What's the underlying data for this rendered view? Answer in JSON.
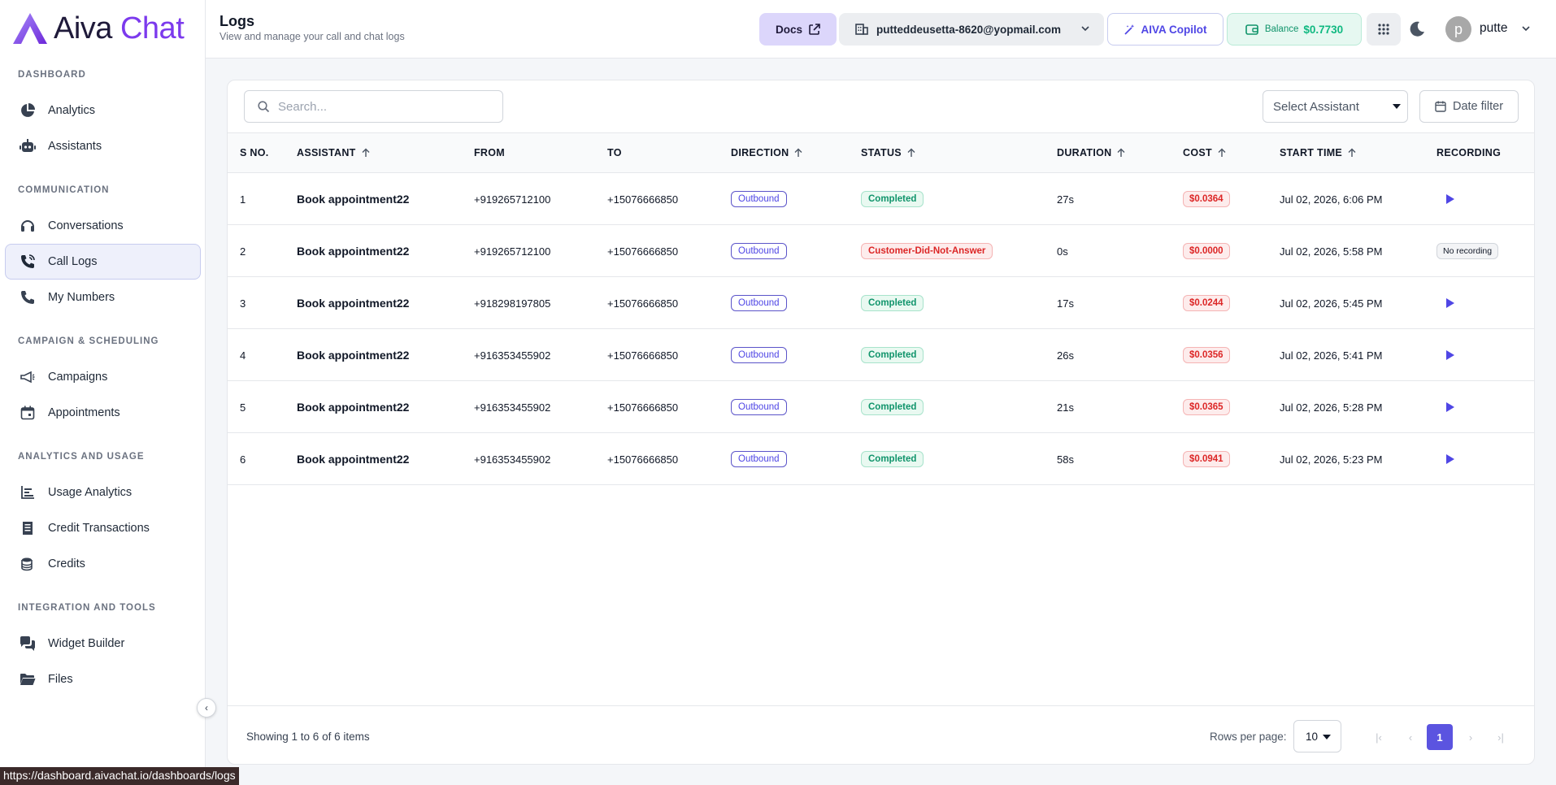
{
  "brand": {
    "name_part1": "Aiva",
    "name_part2": "Chat"
  },
  "header": {
    "title": "Logs",
    "subtitle": "View and manage your call and chat logs",
    "docs_label": "Docs",
    "account_email": "putteddeusetta-8620@yopmail.com",
    "copilot_label": "AIVA Copilot",
    "balance_label": "Balance",
    "balance_value": "$0.7730",
    "avatar_letter": "p",
    "username": "putte"
  },
  "sidebar": {
    "sections": [
      {
        "label": "DASHBOARD",
        "items": [
          {
            "label": "Analytics",
            "icon": "pie-chart-icon"
          },
          {
            "label": "Assistants",
            "icon": "robot-icon"
          }
        ]
      },
      {
        "label": "COMMUNICATION",
        "items": [
          {
            "label": "Conversations",
            "icon": "headset-icon"
          },
          {
            "label": "Call Logs",
            "icon": "phone-call-icon",
            "active": true
          },
          {
            "label": "My Numbers",
            "icon": "phone-icon"
          }
        ]
      },
      {
        "label": "CAMPAIGN & SCHEDULING",
        "items": [
          {
            "label": "Campaigns",
            "icon": "megaphone-icon"
          },
          {
            "label": "Appointments",
            "icon": "calendar-icon"
          }
        ]
      },
      {
        "label": "ANALYTICS AND USAGE",
        "items": [
          {
            "label": "Usage Analytics",
            "icon": "bar-chart-icon"
          },
          {
            "label": "Credit Transactions",
            "icon": "receipt-icon"
          },
          {
            "label": "Credits",
            "icon": "coins-icon"
          }
        ]
      },
      {
        "label": "INTEGRATION AND TOOLS",
        "items": [
          {
            "label": "Widget Builder",
            "icon": "chat-bubbles-icon"
          },
          {
            "label": "Files",
            "icon": "folder-icon"
          }
        ]
      }
    ]
  },
  "toolbar": {
    "search_placeholder": "Search...",
    "select_assistant_label": "Select Assistant",
    "date_filter_label": "Date filter"
  },
  "table": {
    "columns": [
      "S NO.",
      "ASSISTANT",
      "FROM",
      "TO",
      "DIRECTION",
      "STATUS",
      "DURATION",
      "COST",
      "START TIME",
      "RECORDING"
    ],
    "rows": [
      {
        "sno": "1",
        "assistant": "Book appointment22",
        "from": "+919265712100",
        "to": "+15076666850",
        "direction": "Outbound",
        "status": "Completed",
        "duration": "27s",
        "cost": "$0.0364",
        "start_time": "Jul 02, 2026, 6:06 PM",
        "recording": "play"
      },
      {
        "sno": "2",
        "assistant": "Book appointment22",
        "from": "+919265712100",
        "to": "+15076666850",
        "direction": "Outbound",
        "status": "Customer-Did-Not-Answer",
        "duration": "0s",
        "cost": "$0.0000",
        "start_time": "Jul 02, 2026, 5:58 PM",
        "recording": "No recording"
      },
      {
        "sno": "3",
        "assistant": "Book appointment22",
        "from": "+918298197805",
        "to": "+15076666850",
        "direction": "Outbound",
        "status": "Completed",
        "duration": "17s",
        "cost": "$0.0244",
        "start_time": "Jul 02, 2026, 5:45 PM",
        "recording": "play"
      },
      {
        "sno": "4",
        "assistant": "Book appointment22",
        "from": "+916353455902",
        "to": "+15076666850",
        "direction": "Outbound",
        "status": "Completed",
        "duration": "26s",
        "cost": "$0.0356",
        "start_time": "Jul 02, 2026, 5:41 PM",
        "recording": "play"
      },
      {
        "sno": "5",
        "assistant": "Book appointment22",
        "from": "+916353455902",
        "to": "+15076666850",
        "direction": "Outbound",
        "status": "Completed",
        "duration": "21s",
        "cost": "$0.0365",
        "start_time": "Jul 02, 2026, 5:28 PM",
        "recording": "play"
      },
      {
        "sno": "6",
        "assistant": "Book appointment22",
        "from": "+916353455902",
        "to": "+15076666850",
        "direction": "Outbound",
        "status": "Completed",
        "duration": "58s",
        "cost": "$0.0941",
        "start_time": "Jul 02, 2026, 5:23 PM",
        "recording": "play"
      }
    ]
  },
  "footer": {
    "showing_text": "Showing 1 to 6 of 6 items",
    "rows_per_page_label": "Rows per page:",
    "rows_per_page_value": "10",
    "current_page": "1"
  },
  "status_bar_url": "https://dashboard.aivachat.io/dashboards/logs",
  "colors": {
    "accent": "#4f46e5",
    "brand_purple": "#7c3aed",
    "success": "#10946b",
    "danger": "#dc2626"
  }
}
